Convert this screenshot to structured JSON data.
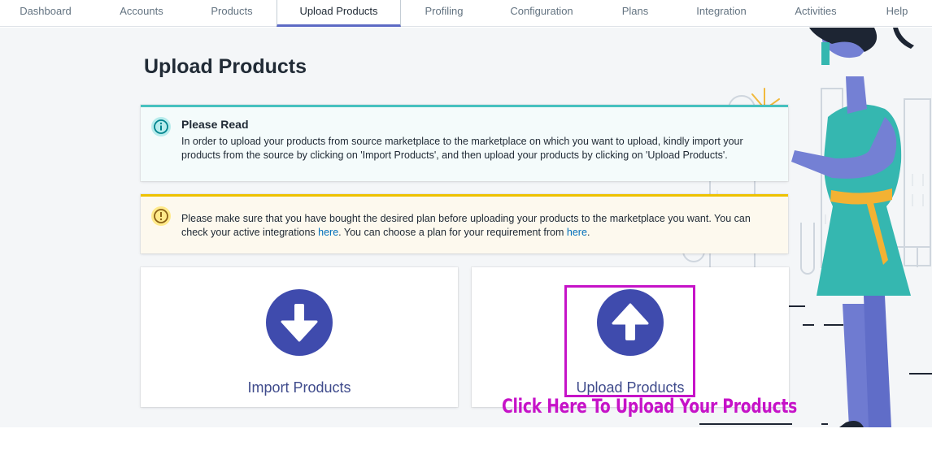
{
  "tabs": [
    {
      "label": "Dashboard",
      "active": false
    },
    {
      "label": "Accounts",
      "active": false
    },
    {
      "label": "Products",
      "active": false
    },
    {
      "label": "Upload Products",
      "active": true
    },
    {
      "label": "Profiling",
      "active": false
    },
    {
      "label": "Configuration",
      "active": false
    },
    {
      "label": "Plans",
      "active": false
    },
    {
      "label": "Integration",
      "active": false
    },
    {
      "label": "Activities",
      "active": false
    },
    {
      "label": "Help",
      "active": false
    }
  ],
  "page": {
    "title": "Upload Products"
  },
  "info_banner": {
    "icon": "info-circle-icon",
    "title": "Please Read",
    "text": "In order to upload your products from source marketplace to the marketplace on which you want to upload, kindly import your products from the source by clicking on 'Import Products', and then upload your products by clicking on 'Upload Products'."
  },
  "warning_banner": {
    "icon": "exclamation-circle-icon",
    "text_1": "Please make sure that you have bought the desired plan before uploading your products to the marketplace you want. You can check your active integrations ",
    "link_1": "here",
    "text_2": ". You can choose a plan for your requirement from ",
    "link_2": "here",
    "text_3": "."
  },
  "cards": {
    "import": {
      "label": "Import Products",
      "icon": "arrow-down-circle-icon"
    },
    "upload": {
      "label": "Upload Products",
      "icon": "arrow-up-circle-icon"
    }
  },
  "annotation": {
    "text": "Click Here To Upload Your Products"
  },
  "colors": {
    "accent": "#5c6ac4",
    "icon_circle": "#3f4bad",
    "highlight": "#c613c8",
    "info_border": "#47c1bf",
    "warning_border": "#eec200",
    "link": "#006fbb"
  }
}
